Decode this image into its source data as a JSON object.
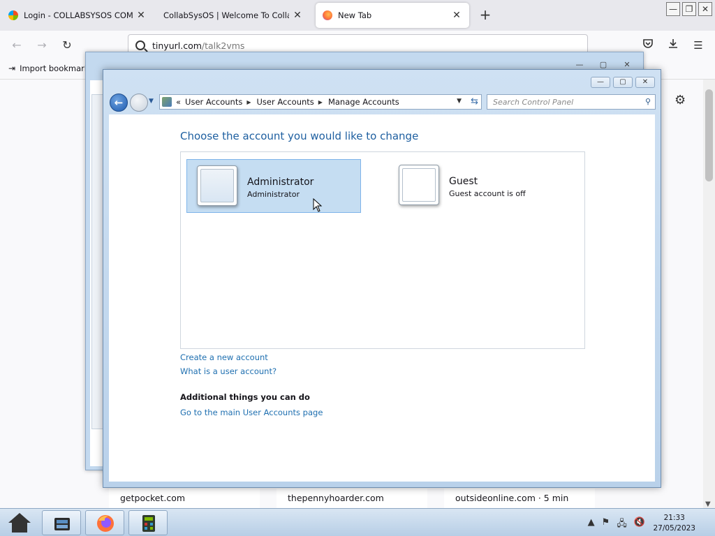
{
  "browser": {
    "tabs": [
      {
        "label": "Login - COLLABSYSOS COMMUNI",
        "active": false
      },
      {
        "label": "CollabSysOS | Welcome To CollabSysOS",
        "active": false
      },
      {
        "label": "New Tab",
        "active": true
      }
    ],
    "new_tab_symbol": "+",
    "url_host": "tinyurl.com",
    "url_path": "/talk2vms",
    "bookmark_label": "Import bookmarks...",
    "shortcuts": [
      "getpocket.com",
      "thepennyhoarder.com",
      "outsideonline.com · 5 min"
    ]
  },
  "control_panel": {
    "breadcrumbs": [
      "User Accounts",
      "User Accounts",
      "Manage Accounts"
    ],
    "breadcrumb_lead": "«",
    "search_placeholder": "Search Control Panel",
    "heading": "Choose the account you would like to change",
    "accounts": [
      {
        "name": "Administrator",
        "subtitle": "Administrator",
        "selected": true
      },
      {
        "name": "Guest",
        "subtitle": "Guest account is off",
        "selected": false
      }
    ],
    "links": {
      "create_account": "Create a new account",
      "what_is": "What is a user account?",
      "main_page": "Go to the main User Accounts page"
    },
    "additional_heading": "Additional things you can do"
  },
  "taskbar": {
    "time": "21:33",
    "date": "27/05/2023"
  },
  "colors": {
    "accent_link": "#1e6fb0",
    "heading": "#1e5fa0",
    "selection": "#c5ddf2",
    "firefox_orange": "#ff7139"
  }
}
